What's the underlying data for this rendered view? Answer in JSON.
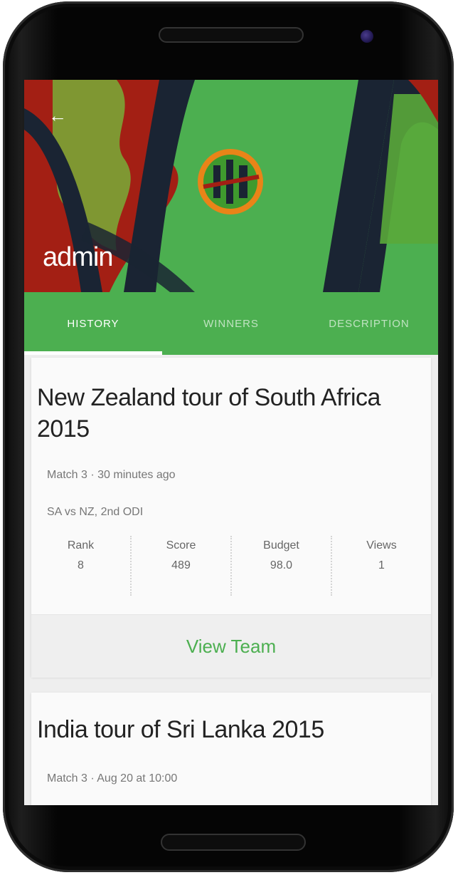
{
  "header": {
    "title": "admin",
    "back_icon": "back-arrow-icon",
    "colors": {
      "primary": "#4caf50",
      "banner_red": "#a31f14",
      "banner_navy": "#1a2433",
      "logo_orange": "#e98418"
    }
  },
  "tabs": [
    {
      "label": "HISTORY",
      "active": true
    },
    {
      "label": "WINNERS",
      "active": false
    },
    {
      "label": "DESCRIPTION",
      "active": false
    }
  ],
  "matches": [
    {
      "title": "New Zealand tour of South Africa 2015",
      "meta_1": "Match 3 · 30 minutes ago",
      "meta_2": "SA vs NZ, 2nd ODI",
      "stats": [
        {
          "label": "Rank",
          "value": "8"
        },
        {
          "label": "Score",
          "value": "489"
        },
        {
          "label": "Budget",
          "value": "98.0"
        },
        {
          "label": "Views",
          "value": "1"
        }
      ],
      "action_label": "View Team"
    },
    {
      "title": "India tour of Sri Lanka 2015",
      "meta_1": "Match 3 · Aug 20 at 10:00"
    }
  ]
}
